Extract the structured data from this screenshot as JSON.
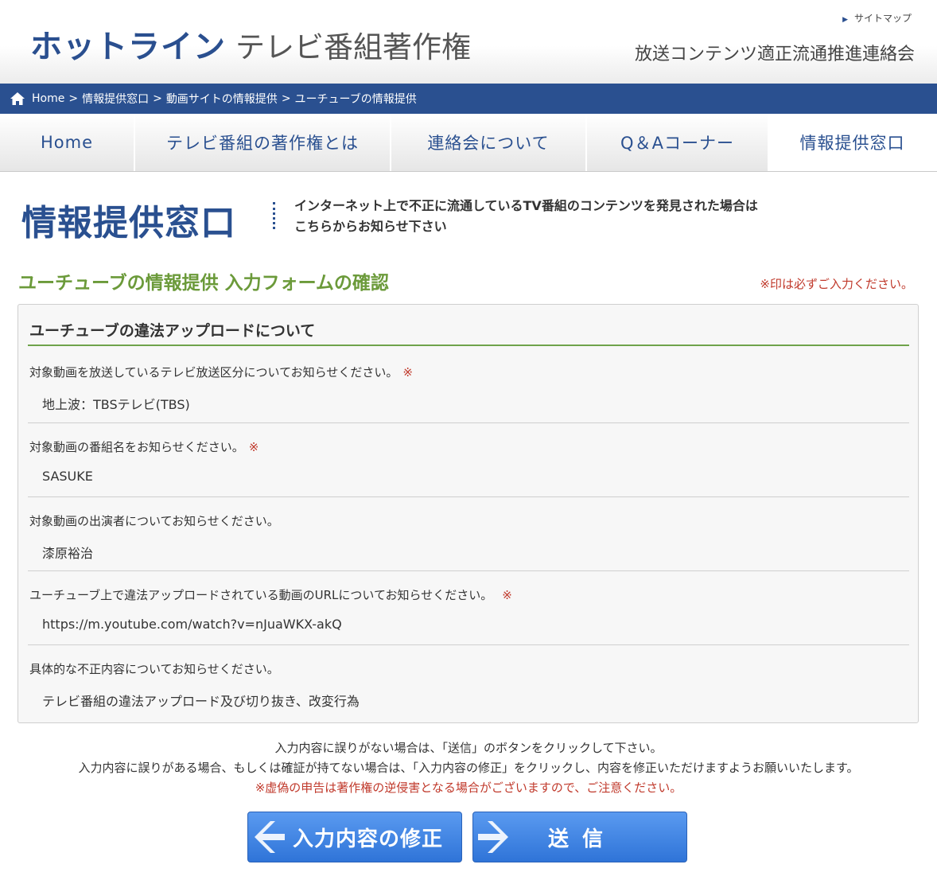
{
  "header": {
    "logo_main": "ホットライン",
    "logo_sub": "テレビ番組著作権",
    "sitemap": "サイトマップ",
    "org": "放送コンテンツ適正流通推進連絡会"
  },
  "breadcrumb": [
    "Home",
    "情報提供窓口",
    "動画サイトの情報提供",
    "ユーチューブの情報提供"
  ],
  "nav": [
    "Home",
    "テレビ番組の著作権とは",
    "連絡会について",
    "Q＆Aコーナー",
    "情報提供窓口"
  ],
  "page": {
    "title": "情報提供窓口",
    "desc_line1": "インターネット上で不正に流通しているTV番組のコンテンツを発見された場合は",
    "desc_line2": "こちらからお知らせ下さい",
    "section_title": "ユーチューブの情報提供 入力フォームの確認",
    "required_note": "※印は必ずご入力ください。"
  },
  "form": {
    "title": "ユーチューブの違法アップロードについて",
    "rows": [
      {
        "label": "対象動画を放送しているテレビ放送区分についてお知らせください。",
        "required": "※",
        "value": "地上波：TBSテレビ(TBS)"
      },
      {
        "label": "対象動画の番組名をお知らせください。",
        "required": "※",
        "value": "SASUKE"
      },
      {
        "label": "対象動画の出演者についてお知らせください。",
        "required": "",
        "value": "漆原裕治"
      },
      {
        "label": "ユーチューブ上で違法アップロードされている動画のURLについてお知らせください。",
        "required": "※",
        "value": "https://m.youtube.com/watch?v=nJuaWKX-akQ"
      },
      {
        "label": "具体的な不正内容についてお知らせください。",
        "required": "",
        "value": "テレビ番組の違法アップロード及び切り抜き、改変行為"
      }
    ]
  },
  "notes": {
    "line1": "入力内容に誤りがない場合は、「送信」のボタンをクリックして下さい。",
    "line2": "入力内容に誤りがある場合、もしくは確証が持てない場合は、「入力内容の修正」をクリックし、内容を修正いただけますようお願いいたします。",
    "warning": "※虚偽の申告は著作権の逆侵害となる場合がございますので、ご注意ください。"
  },
  "buttons": {
    "back": "入力内容の修正",
    "send": "送 信"
  }
}
